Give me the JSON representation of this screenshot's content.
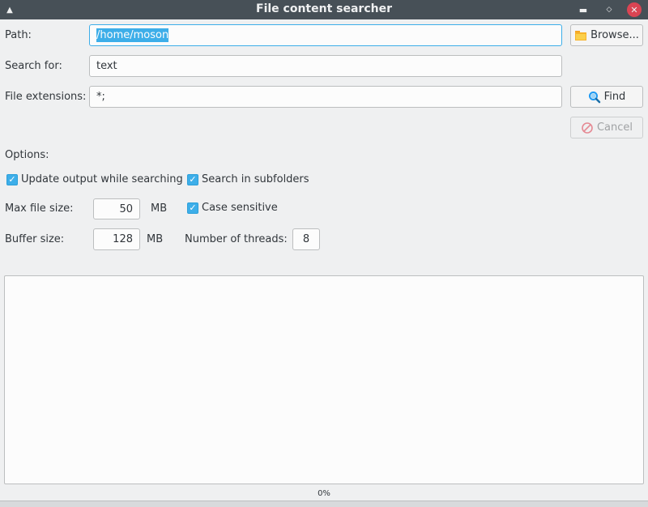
{
  "window": {
    "title": "File content searcher",
    "menu_icon": "▲",
    "min_icon": "▬",
    "max_icon": "◇",
    "close_icon": "✕"
  },
  "form": {
    "path_label": "Path:",
    "path_value": "/home/moson",
    "search_label": "Search for:",
    "search_value": "text",
    "ext_label": "File extensions:",
    "ext_value": "*;",
    "browse_label": "Browse...",
    "find_label": "Find",
    "cancel_label": "Cancel"
  },
  "options": {
    "heading": "Options:",
    "update_output": {
      "label": "Update output while searching",
      "checked": true
    },
    "subfolders": {
      "label": "Search in subfolders",
      "checked": true
    },
    "case_sensitive": {
      "label": "Case sensitive",
      "checked": true
    },
    "max_file_size_label": "Max file size:",
    "max_file_size_value": "50",
    "max_file_size_unit": "MB",
    "buffer_size_label": "Buffer size:",
    "buffer_size_value": "128",
    "buffer_size_unit": "MB",
    "threads_label": "Number of threads:",
    "threads_value": "8"
  },
  "status": {
    "progress_text": "0%",
    "progress_fraction": 0
  },
  "colors": {
    "accent": "#3daee9",
    "titlebar": "#475057",
    "close_button": "#da4453",
    "cancel_icon": "#da4453"
  }
}
